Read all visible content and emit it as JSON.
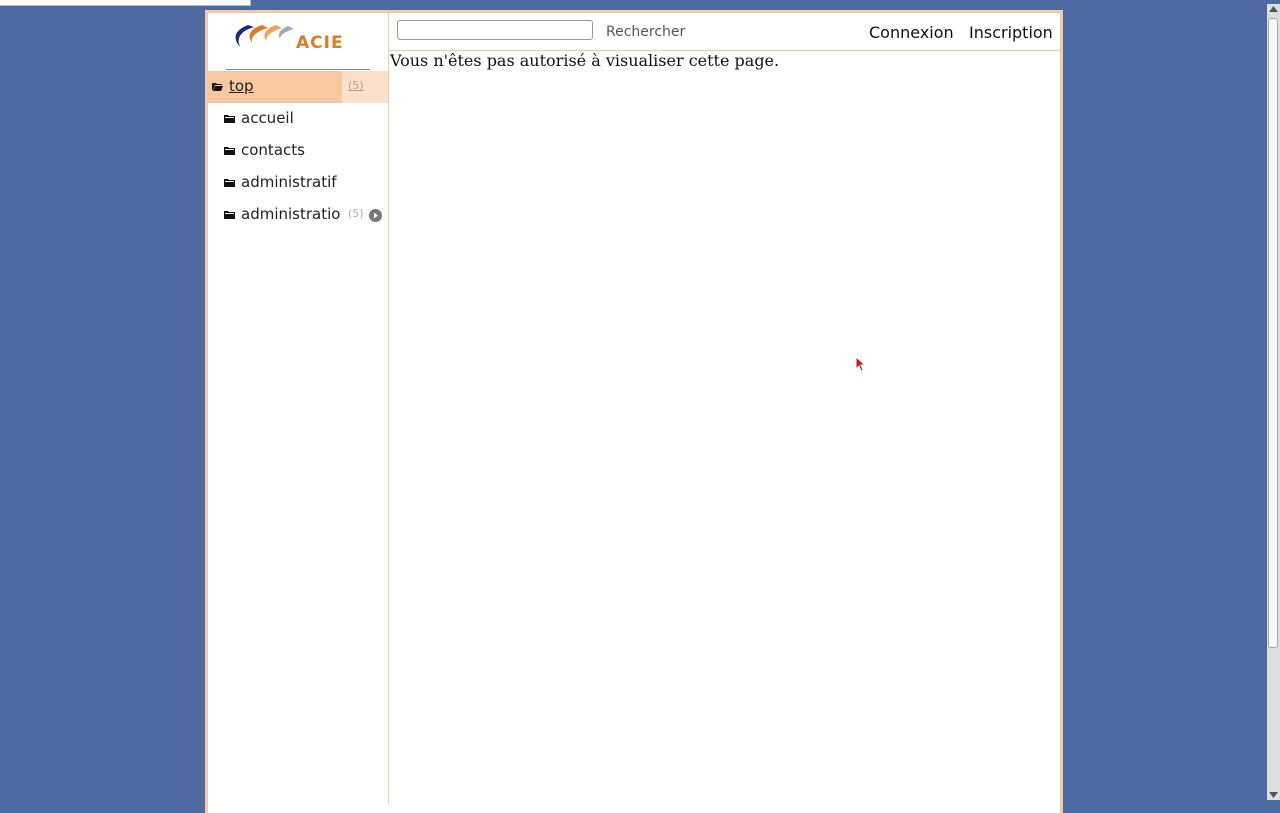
{
  "header": {
    "logo_text": "ACIE",
    "search_placeholder": "",
    "search_button": "Rechercher",
    "login_link": "Connexion",
    "signup_link": "Inscription"
  },
  "sidebar": {
    "items": [
      {
        "label": "top",
        "count": "(5)",
        "icon": "folder-open-icon",
        "selected": true
      },
      {
        "label": "accueil",
        "icon": "folder-icon"
      },
      {
        "label": "contacts",
        "icon": "folder-icon"
      },
      {
        "label": "administratif",
        "icon": "folder-icon"
      },
      {
        "label": "administratio",
        "count": "(5)",
        "icon": "folder-icon",
        "expand_icon": "arrow-right-icon"
      }
    ]
  },
  "main": {
    "message": "Vous n'êtes pas autorisé à visualiser cette page."
  },
  "colors": {
    "page_background": "#4e6aa2",
    "frame_border": "#f5c9a8",
    "selected_item": "#f8c8a0",
    "logo_orange": "#e07a1f",
    "logo_blue": "#1a2d7a"
  }
}
